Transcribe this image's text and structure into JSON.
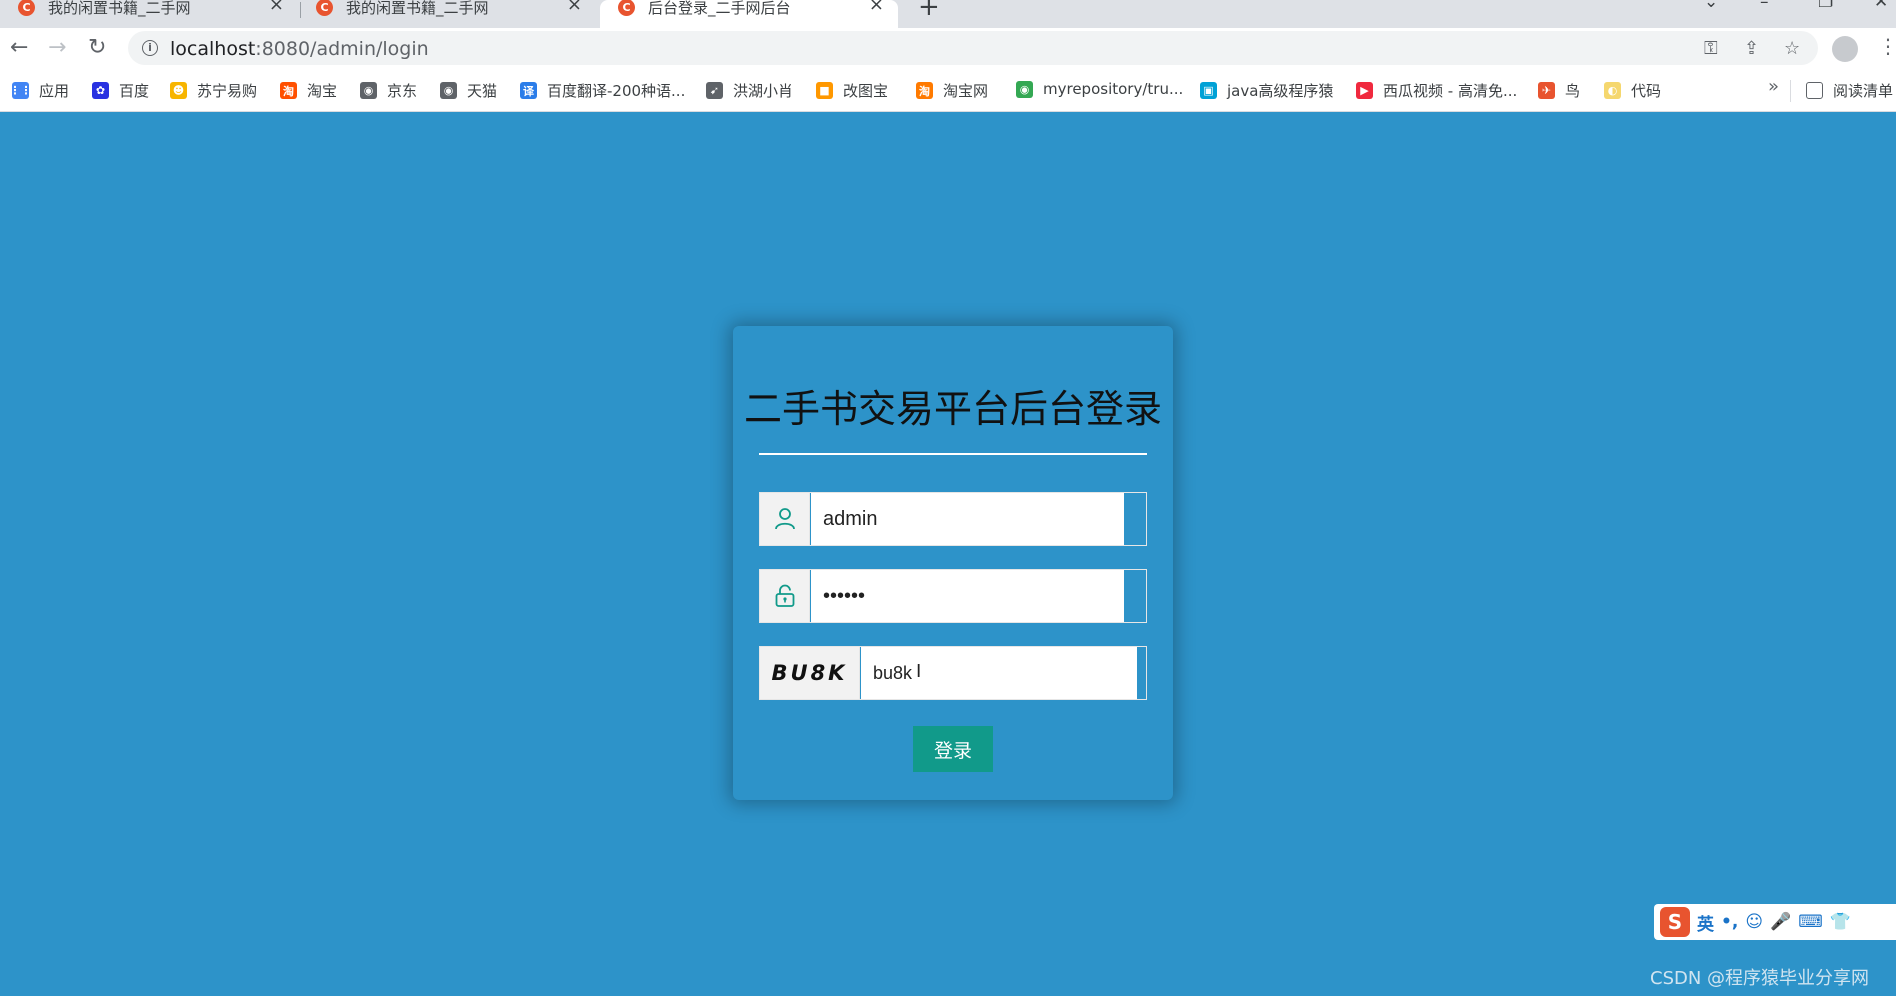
{
  "browser": {
    "tabs": [
      {
        "title": "我的闲置书籍_二手网",
        "active": false
      },
      {
        "title": "我的闲置书籍_二手网",
        "active": false
      },
      {
        "title": "后台登录_二手网后台",
        "active": true
      }
    ],
    "favicon_letter": "C",
    "new_tab_label": "+",
    "url_host": "localhost",
    "url_path": ":8080/admin/login",
    "bookmarks": [
      {
        "label": "应用",
        "icon": "apps-icon",
        "color": "#4285f4"
      },
      {
        "label": "百度",
        "icon": "baidu-paw-icon",
        "color": "#2932e1"
      },
      {
        "label": "苏宁易购",
        "icon": "suning-lion-icon",
        "color": "#f7b500"
      },
      {
        "label": "淘宝",
        "icon": "taobao-icon",
        "color": "#ff5000"
      },
      {
        "label": "京东",
        "icon": "globe-icon",
        "color": "#5f6368"
      },
      {
        "label": "天猫",
        "icon": "globe-icon",
        "color": "#5f6368"
      },
      {
        "label": "百度翻译-200种语...",
        "icon": "translate-icon",
        "color": "#2b7de9"
      },
      {
        "label": "洪湖小肖",
        "icon": "fish-icon",
        "color": "#5f6368"
      },
      {
        "label": "改图宝",
        "icon": "image-edit-icon",
        "color": "#ff9800"
      },
      {
        "label": "淘宝网",
        "icon": "taobao-icon",
        "color": "#ff7a00"
      },
      {
        "label": "myrepository/tru...",
        "icon": "chrome-icon",
        "color": "#34a853"
      },
      {
        "label": "java高级程序猿",
        "icon": "bilibili-icon",
        "color": "#00a1d6"
      },
      {
        "label": "西瓜视频 - 高清免...",
        "icon": "xigua-icon",
        "color": "#f0293e"
      },
      {
        "label": "鸟",
        "icon": "bird-icon",
        "color": "#e8542f"
      },
      {
        "label": "代码",
        "icon": "code-icon",
        "color": "#f5d76e"
      }
    ],
    "reading_list_label": "阅读清单",
    "more_bookmarks": "»"
  },
  "login": {
    "title": "二手书交易平台后台登录",
    "username_value": "admin",
    "password_value": "••••••",
    "captcha_code": "BU8K",
    "captcha_value": "bu8k",
    "submit_label": "登录"
  },
  "ime": {
    "logo": "S",
    "lang": "英",
    "items": [
      "•,",
      "☺",
      "🎤",
      "⌨",
      "👕"
    ]
  },
  "watermark": "CSDN @程序猿毕业分享网"
}
